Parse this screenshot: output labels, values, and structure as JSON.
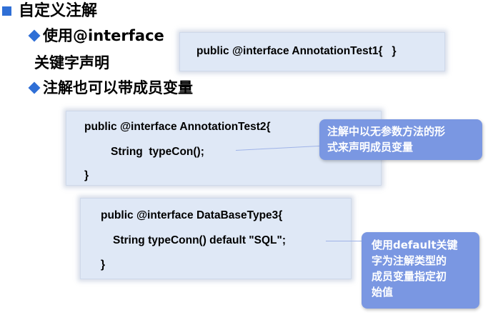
{
  "heading": {
    "title": "自定义注解"
  },
  "bullets": {
    "item1_line1": "使用@interface",
    "item1_line2": "关键字声明",
    "item2": "注解也可以带成员变量"
  },
  "code1": {
    "line1": "public @interface AnnotationTest1{   }"
  },
  "code2": {
    "line1": "public @interface AnnotationTest2{",
    "line2": "String  typeCon();",
    "line3": "}"
  },
  "code3": {
    "line1": "public @interface DataBaseType3{",
    "line2": "String typeConn() default \"SQL\";",
    "line3": "}"
  },
  "callouts": {
    "callout1": "注解中以无参数方法的形\n式来声明成员变量",
    "callout2": "使用default关键\n字为注解类型的\n成员变量指定初\n始值"
  },
  "colors": {
    "accent": "#2f6fd6",
    "code_background": "#dfe8f6",
    "callout_background": "#7a97e2"
  }
}
